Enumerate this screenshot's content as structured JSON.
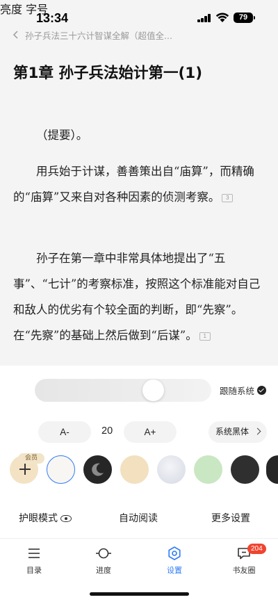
{
  "status_bar": {
    "time": "13:34",
    "battery": "79"
  },
  "header": {
    "breadcrumb": "孙子兵法三十六计智谋全解（超值全..."
  },
  "content": {
    "chapter_title": "第1章 孙子兵法始计第一(1)",
    "paragraphs": [
      {
        "text": "（提要）。",
        "note": ""
      },
      {
        "text": "用兵始于计谋，善善策出自“庙算”，而精确的“庙算”又来自对各种因素的侦测考察。",
        "note": "3"
      },
      {
        "text": "孙子在第一章中非常具体地提出了“五事”、“七计”的考察标准，按照这个标准能对自己和敌人的优劣有个较全面的判断，即“先察”。在“先察”的基础上然后做到“后谋”。",
        "note": "1"
      }
    ]
  },
  "settings": {
    "brightness_label": "亮度",
    "brightness_level_percent": 70,
    "follow_system_label": "跟随系统",
    "font_size_label": "字号",
    "font_decrease": "A-",
    "font_size_value": "20",
    "font_increase": "A+",
    "font_face": "系统黑体",
    "vip_badge": "会员",
    "themes": [
      {
        "name": "custom-theme",
        "color": "#f3e3c4"
      },
      {
        "name": "white-theme",
        "color": "#f8f6f2",
        "selected": true
      },
      {
        "name": "night-theme",
        "color": "#262626"
      },
      {
        "name": "parchment-theme",
        "color": "#f2e0bf"
      },
      {
        "name": "silver-theme",
        "color": "#dfe2ea"
      },
      {
        "name": "green-theme",
        "color": "#c9e7c2"
      },
      {
        "name": "dark-theme",
        "color": "#2f2f2f"
      },
      {
        "name": "black-theme",
        "color": "#262626"
      }
    ],
    "eye_care_label": "护眼模式",
    "auto_read_label": "自动阅读",
    "more_settings_label": "更多设置"
  },
  "tabbar": {
    "items": [
      {
        "label": "目录",
        "icon": "list-icon"
      },
      {
        "label": "进度",
        "icon": "progress-icon"
      },
      {
        "label": "设置",
        "icon": "settings-icon",
        "active": true
      },
      {
        "label": "书友圈",
        "icon": "chat-icon"
      }
    ],
    "badge": "204"
  },
  "colors": {
    "accent": "#2f7bf6",
    "badge": "#f0442f"
  }
}
